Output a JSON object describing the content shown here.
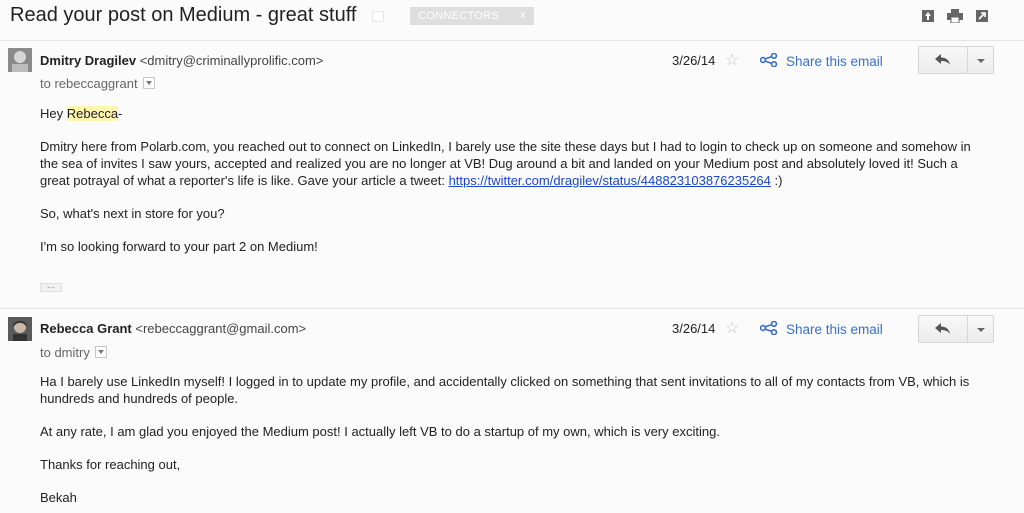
{
  "thread": {
    "subject": "Read your post on Medium - great stuff",
    "label": "CONNECTORS",
    "label_remove": "x"
  },
  "icons": {
    "top": [
      "archive-icon",
      "print-icon",
      "new-window-icon"
    ]
  },
  "messages": [
    {
      "sender_name": "Dmitry Dragilev",
      "sender_email": "<dmitry@criminallyprolific.com>",
      "to": "to rebeccaggrant",
      "date": "3/26/14",
      "share_label": "Share this email",
      "greeting_prefix": "Hey ",
      "greeting_name": "Rebecca",
      "greeting_suffix": "-",
      "para1": "Dmitry here from Polarb.com, you reached out to connect on LinkedIn, I barely use the site these days but I had to login to check up on someone and somehow in the sea of invites I saw yours, accepted and realized you are no longer at VB! Dug around a bit and landed on your Medium post and absolutely loved it! Such a great potrayal of what a reporter's life is like. Gave your article a tweet: ",
      "link": "https://twitter.com/dragilev/status/448823103876235264",
      "para1_end": " :)",
      "para2": "So, what's next in store for you?",
      "para3": "I'm so looking forward to your part 2 on Medium!",
      "ellipsis": "..."
    },
    {
      "sender_name": "Rebecca Grant",
      "sender_email": "<rebeccaggrant@gmail.com>",
      "to": "to dmitry",
      "date": "3/26/14",
      "share_label": "Share this email",
      "para1": "Ha I barely use LinkedIn myself! I logged in to update my profile, and accidentally clicked on something that sent invitations to all of my contacts from VB, which is hundreds and hundreds of people.",
      "para2": "At any rate, I am glad you enjoyed the Medium post! I actually left VB to do a startup of my own, which is very exciting.",
      "para3": "Thanks for reaching out,",
      "para4": "Bekah"
    }
  ],
  "colors": {
    "link": "#1a47c9",
    "share": "#3b6fc8",
    "highlight": "#fff5b0",
    "label_bg": "#dedede"
  }
}
